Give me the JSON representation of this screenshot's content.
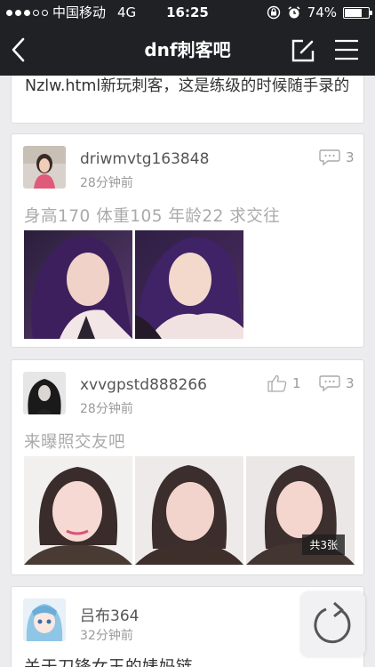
{
  "status_bar": {
    "carrier": "中国移动",
    "network": "4G",
    "time": "16:25",
    "battery": "74%",
    "battery_level": 0.74
  },
  "nav": {
    "title": "dnf刺客吧"
  },
  "posts": [
    {
      "text": "Nzlw.html新玩刺客，这是练级的时候随手录的"
    },
    {
      "username": "driwmvtg163848",
      "time": "28分钟前",
      "title": "身高170 体重105 年龄22 求交往",
      "comments": "3"
    },
    {
      "username": "xvvgpstd888266",
      "time": "28分钟前",
      "title": "来曝照交友吧",
      "likes": "1",
      "comments": "3",
      "photo_count": "共3张"
    },
    {
      "username": "吕布364",
      "time": "32分钟前",
      "title": "关于刀锋女王的婊妈链"
    }
  ],
  "colors": {
    "header_bg": "#1f2125",
    "page_bg": "#ececee",
    "card_bg": "#ffffff",
    "muted_text": "#9a9a9a"
  }
}
